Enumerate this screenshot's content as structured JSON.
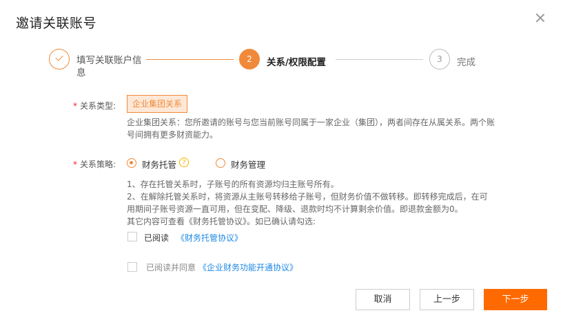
{
  "dialog": {
    "title": "邀请关联账号",
    "close_icon": "close-icon"
  },
  "steps": [
    {
      "number": "1",
      "label": "填写关联账户信息",
      "state": "done"
    },
    {
      "number": "2",
      "label": "关系/权限配置",
      "state": "active"
    },
    {
      "number": "3",
      "label": "完成",
      "state": "pending"
    }
  ],
  "relation_type": {
    "required_mark": "*",
    "label": "关系类型:",
    "selected": "企业集团关系",
    "description": "企业集团关系：您所邀请的账号与您当前账号同属于一家企业（集团），两者间存在从属关系。两个账号间拥有更多财资能力。"
  },
  "relation_policy": {
    "required_mark": "*",
    "label": "关系策略:",
    "options": [
      {
        "label": "财务托管",
        "selected": true
      },
      {
        "label": "财务管理",
        "selected": false
      }
    ],
    "help_icon": "?",
    "description_lines": [
      "1、存在托管关系时，子账号的所有资源均归主账号所有。",
      "2、在解除托管关系时，将资源从主账号转移给子账号，但财务价值不做转移。即转移完成后，在可用期间子账号资源一直可用，但在变配、降级、退款时均不计算剩余价值。即退款金额为0。",
      "其它内容可查看《财务托管协议》。如已确认请勾选:"
    ]
  },
  "agreements": [
    {
      "text": "已阅读",
      "link": "《财务托管协议》",
      "checked": false
    },
    {
      "text": "已阅读并同意",
      "link": "《企业财务功能开通协议》",
      "checked": false
    }
  ],
  "buttons": {
    "cancel": "取消",
    "prev": "上一步",
    "next": "下一步"
  },
  "colors": {
    "accent": "#f08a3a",
    "primary_button": "#ff6a00",
    "link": "#1e88e5",
    "required": "#f5222d"
  }
}
